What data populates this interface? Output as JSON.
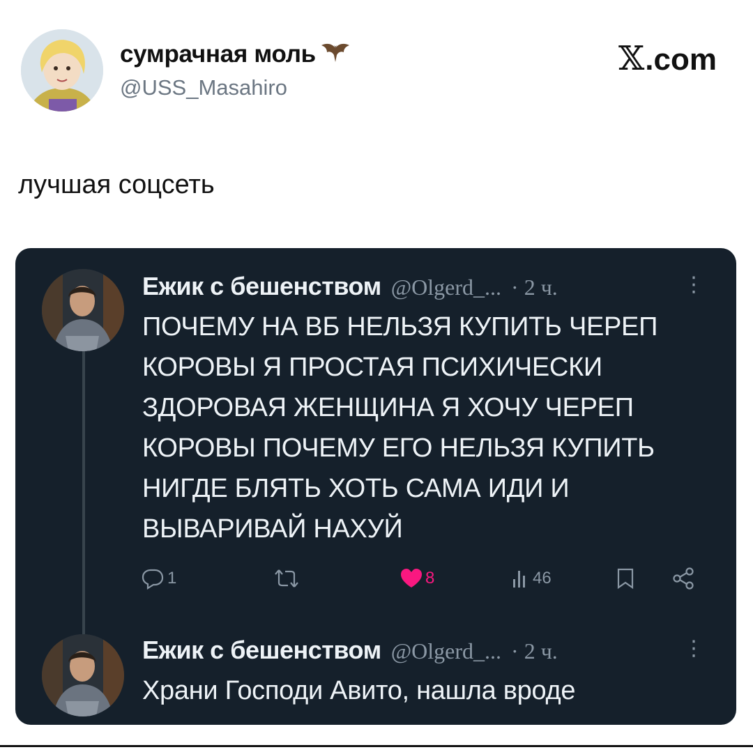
{
  "post": {
    "author_name": "сумрачная моль",
    "author_handle": "@USS_Masahiro",
    "site": "𝕏.com",
    "site_x": "𝕏",
    "site_rest": ".com",
    "text": "лучшая соцсеть"
  },
  "embedded": {
    "replies": [
      {
        "name": "Ежик с бешенством",
        "handle": "@Olgerd_...",
        "time": "· 2 ч.",
        "text_lines": [
          "ПОЧЕМУ НА ВБ НЕЛЬЗЯ КУПИТЬ ЧЕРЕП",
          "КОРОВЫ Я ПРОСТАЯ ПСИХИЧЕСКИ",
          "ЗДОРОВАЯ ЖЕНЩИНА Я ХОЧУ ЧЕРЕП",
          "КОРОВЫ ПОЧЕМУ ЕГО НЕЛЬЗЯ КУПИТЬ",
          "НИГДЕ БЛЯТЬ ХОТЬ САМА ИДИ И",
          "ВЫВАРИВАЙ НАХУЙ"
        ],
        "stats": {
          "replies": "1",
          "likes": "8",
          "views": "46"
        }
      },
      {
        "name": "Ежик с бешенством",
        "handle": "@Olgerd_...",
        "time": "· 2 ч.",
        "text": "Храни Господи Авито, нашла вроде"
      }
    ]
  },
  "icons": {
    "header": [
      "avatar",
      "bat-icon"
    ],
    "actions": [
      "reply-icon",
      "retweet-icon",
      "heart-icon",
      "views-icon",
      "bookmark-icon",
      "share-icon"
    ]
  },
  "colors": {
    "card_bg": "#15202b",
    "muted": "#8b98a5",
    "like": "#f91880",
    "text_dark": "#eef3f7"
  }
}
